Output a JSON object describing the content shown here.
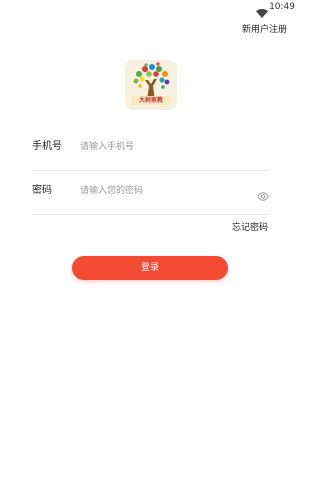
{
  "status_bar": {
    "time": "10:49",
    "wifi_icon": "wifi-icon"
  },
  "header": {
    "register_label": "新用户注册"
  },
  "logo": {
    "text": "大树家教",
    "icon": "tree-logo"
  },
  "form": {
    "phone": {
      "label": "手机号",
      "placeholder": "请输入手机号",
      "value": ""
    },
    "password": {
      "label": "密码",
      "placeholder": "请输入您的密码",
      "value": "",
      "toggle_icon": "eye-icon"
    },
    "forgot_label": "忘记密码",
    "login_label": "登录"
  },
  "colors": {
    "accent": "#f24a33",
    "divider": "#ececec",
    "placeholder": "#9a9a9a"
  }
}
